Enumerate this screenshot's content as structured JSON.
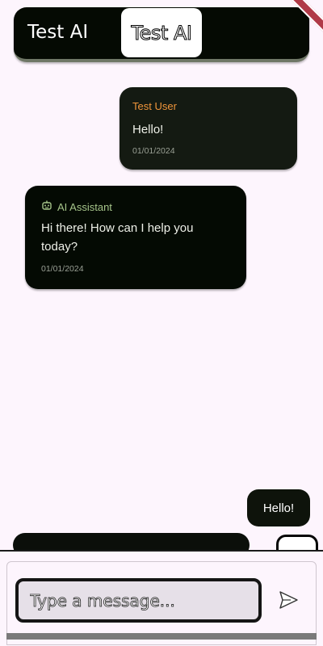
{
  "app_bar": {
    "title": "Test AI",
    "chip_title": "Test AI"
  },
  "messages": [
    {
      "sender": "Test User",
      "text": "Hello!",
      "time": "01/01/2024",
      "sender_color": "#f0953a"
    },
    {
      "sender": "AI Assistant",
      "icon": "robot-icon",
      "text": "Hi there! How can I help you today?",
      "time": "01/01/2024",
      "sender_color": "#a6c58a"
    }
  ],
  "latest_message": "Hello!",
  "composer": {
    "placeholder": "Type a message..."
  },
  "colors": {
    "background": "#fdf5fd",
    "app_bar": "#050a03",
    "user_bubble": "#141a12",
    "ai_bubble": "#040a03"
  }
}
